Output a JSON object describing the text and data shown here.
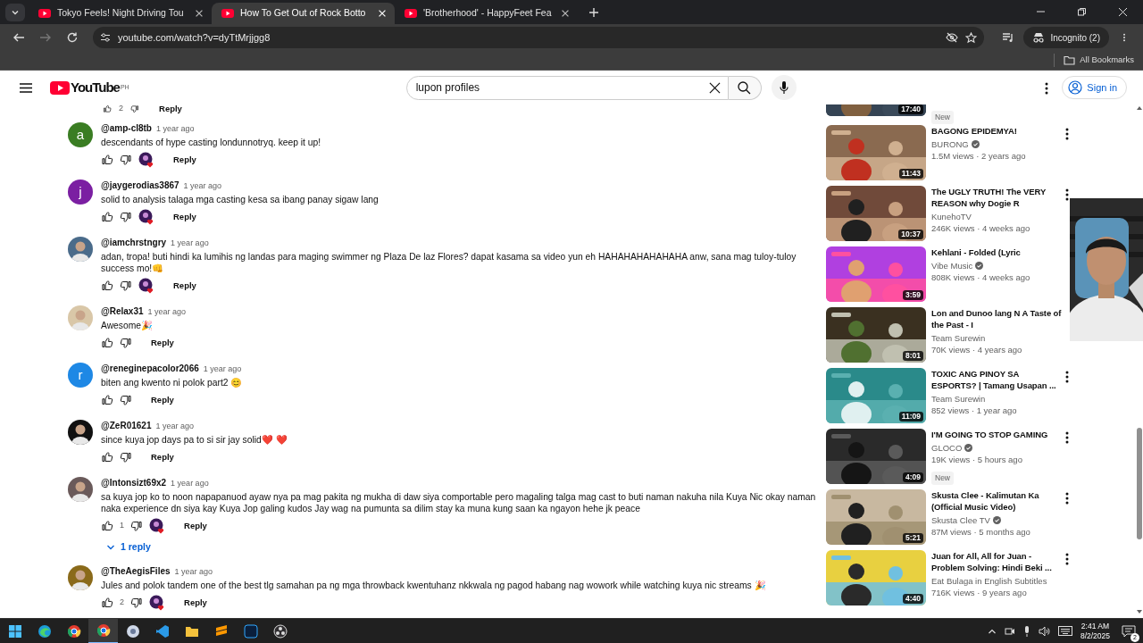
{
  "browser": {
    "tabs": [
      {
        "title": "Tokyo Feels! Night Driving Tou",
        "selected": false
      },
      {
        "title": "How To Get Out of Rock Botto",
        "selected": true
      },
      {
        "title": "'Brotherhood' - HappyFeet Fea",
        "selected": false
      }
    ],
    "address": "youtube.com/watch?v=dyTtMrjjgg8",
    "profile": "Incognito (2)",
    "bookmarks": "All Bookmarks"
  },
  "header": {
    "logo": "YouTube",
    "region": "PH",
    "search": {
      "value": "lupon profiles"
    },
    "sign_in": "Sign in"
  },
  "comments": {
    "partial": {
      "likes": "2",
      "reply": "Reply"
    },
    "items": [
      {
        "author": "@amp-cl8tb",
        "time": "1 year ago",
        "text": "descendants of hype casting londunnotryq. keep it up!",
        "avatar": {
          "kind": "letter",
          "letter": "a",
          "color": "#3a7d23"
        },
        "hearted": true,
        "reply": "Reply"
      },
      {
        "author": "@jaygerodias3867",
        "time": "1 year ago",
        "text": "solid to analysis talaga mga casting kesa sa ibang panay sigaw lang",
        "avatar": {
          "kind": "letter",
          "letter": "j",
          "color": "#7b1fa2"
        },
        "hearted": true,
        "reply": "Reply"
      },
      {
        "author": "@iamchrstngry",
        "time": "1 year ago",
        "text": "adan, tropa! buti hindi ka lumihis ng landas para maging swimmer ng Plaza De laz Flores? dapat kasama sa video yun eh HAHAHAHAHAHAHA anw, sana mag tuloy-tuloy success mo!👊",
        "hearted": true,
        "reply": "Reply"
      },
      {
        "author": "@Relax31",
        "time": "1 year ago",
        "text": "Awesome🎉",
        "hearted": false,
        "reply": "Reply"
      },
      {
        "author": "@reneginepacolor2066",
        "time": "1 year ago",
        "text": "biten ang kwento ni polok part2 😊",
        "avatar": {
          "kind": "letter",
          "letter": "r",
          "color": "#1e88e5"
        },
        "hearted": false,
        "reply": "Reply"
      },
      {
        "author": "@ZeR01621",
        "time": "1 year ago",
        "text": "since kuya jop  days pa to si sir jay solid❤️ ❤️",
        "hearted": false,
        "reply": "Reply"
      },
      {
        "author": "@Intonsizt69x2",
        "time": "1 year ago",
        "text": "sa kuya jop ko to noon napapanuod ayaw nya pa mag pakita ng mukha di daw siya comportable pero magaling talga mag cast to buti naman nakuha nila Kuya Nic okay naman naka experience dn siya kay Kuya Jop galing kudos Jay wag na pumunta sa dilim stay ka muna kung saan ka ngayon hehe jk peace",
        "likes": "1",
        "hearted": true,
        "reply": "Reply",
        "replies": "1 reply"
      },
      {
        "author": "@TheAegisFiles",
        "time": "1 year ago",
        "text": "Jules and polok tandem one of the best tlg samahan pa ng mga throwback kwentuhanz nkkwala ng pagod habang nag wowork while watching kuya nic streams 🎉",
        "likes": "2",
        "hearted": true,
        "reply": "Reply"
      }
    ]
  },
  "videos": [
    {
      "kind": "partial",
      "duration": "17:40",
      "badge": "New"
    },
    {
      "kind": "video",
      "title": "BAGONG EPIDEMYA!",
      "channel": "BURONG",
      "verified": true,
      "meta": "1.5M views · 2 years ago",
      "duration": "11:43",
      "menu": true
    },
    {
      "kind": "video",
      "title": "The UGLY TRUTH! The VERY REASON why Dogie R",
      "channel": "KunehoTV",
      "verified": false,
      "meta": "246K views · 4 weeks ago",
      "duration": "10:37",
      "menu": true
    },
    {
      "kind": "video",
      "title": "Kehlani - Folded (Lyric",
      "channel": "Vibe Music",
      "verified": true,
      "meta": "808K views · 4 weeks ago",
      "duration": "3:59",
      "menu": false
    },
    {
      "kind": "video",
      "title": "Lon and Dunoo lang N A Taste of the Past - I",
      "channel": "Team Surewin",
      "verified": false,
      "meta": "70K views · 4 years ago",
      "duration": "8:01",
      "menu": false
    },
    {
      "kind": "video",
      "title": "TOXIC ANG PINOY SA ESPORTS? | Tamang Usapan ...",
      "channel": "Team Surewin",
      "verified": false,
      "meta": "852 views · 1 year ago",
      "duration": "11:09",
      "menu": true
    },
    {
      "kind": "video",
      "title": "I'M GOING TO STOP GAMING",
      "channel": "GLOCO",
      "verified": true,
      "meta": "19K views · 5 hours ago",
      "badge": "New",
      "duration": "4:09",
      "menu": true
    },
    {
      "kind": "video",
      "title": "Skusta Clee - Kalimutan Ka (Official Music Video)",
      "channel": "Skusta Clee TV",
      "verified": true,
      "meta": "87M views · 5 months ago",
      "duration": "5:21",
      "menu": true
    },
    {
      "kind": "video",
      "title": "Juan for All, All for Juan - Problem Solving: Hindi Beki ...",
      "channel": "Eat Bulaga in English Subtitles",
      "verified": false,
      "meta": "716K views · 9 years ago",
      "duration": "4:40",
      "menu": true
    }
  ],
  "taskbar": {
    "apps": [
      {
        "kind": "start",
        "selected": false
      },
      {
        "kind": "edge",
        "selected": false
      },
      {
        "kind": "chrome",
        "selected": false
      },
      {
        "kind": "chrome",
        "selected": true
      },
      {
        "kind": "app",
        "selected": false
      },
      {
        "kind": "code",
        "selected": false
      },
      {
        "kind": "folder",
        "selected": false
      },
      {
        "kind": "sublime",
        "selected": false
      },
      {
        "kind": "photoshop",
        "selected": false
      },
      {
        "kind": "obs",
        "selected": false
      }
    ],
    "time": "2:41 AM",
    "date": "8/2/2025",
    "notifications": "2"
  }
}
